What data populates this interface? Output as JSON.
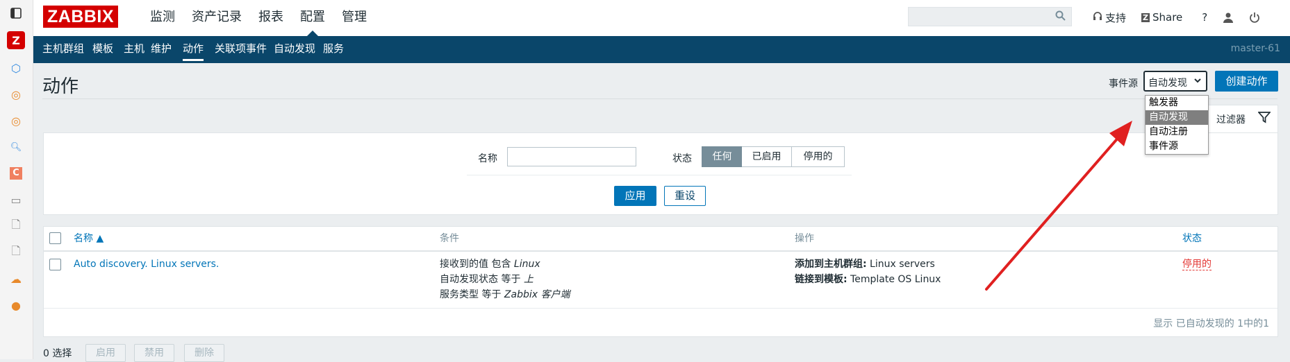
{
  "header": {
    "logo": "ZABBIX",
    "menu": [
      {
        "label": "监测"
      },
      {
        "label": "资产记录"
      },
      {
        "label": "报表"
      },
      {
        "label": "配置"
      },
      {
        "label": "管理"
      }
    ],
    "active_menu": "配置",
    "search_placeholder": "",
    "support_label": "支持",
    "share_label": "Share",
    "help_label": "?"
  },
  "submenu": {
    "items": [
      {
        "label": "主机群组"
      },
      {
        "label": "模板"
      },
      {
        "label": "主机"
      },
      {
        "label": "维护"
      },
      {
        "label": "动作"
      },
      {
        "label": "关联项事件"
      },
      {
        "label": "自动发现"
      },
      {
        "label": "服务"
      }
    ],
    "active": "动作",
    "node_name": "master-61"
  },
  "page": {
    "title": "动作",
    "event_source_label": "事件源",
    "event_source_value": "自动发现",
    "event_source_options": [
      "触发器",
      "自动发现",
      "自动注册",
      "事件源"
    ],
    "create_button": "创建动作",
    "filter_tab_label": "过滤器"
  },
  "filter": {
    "name_label": "名称",
    "name_value": "",
    "status_label": "状态",
    "status_options": [
      "任何",
      "已启用",
      "停用的"
    ],
    "status_selected": "任何",
    "apply_button": "应用",
    "reset_button": "重设"
  },
  "table": {
    "columns": {
      "name": "名称 ▲",
      "conditions": "条件",
      "operations": "操作",
      "status": "状态"
    },
    "rows": [
      {
        "name": "Auto discovery. Linux servers.",
        "conditions": [
          {
            "prefix": "接收到的值 包含 ",
            "value": "Linux"
          },
          {
            "prefix": "自动发现状态 等于 ",
            "value": "上"
          },
          {
            "prefix": "服务类型 等于 ",
            "value": "Zabbix 客户端"
          }
        ],
        "operations": [
          {
            "key": "添加到主机群组:",
            "value": " Linux servers"
          },
          {
            "key": "链接到模板:",
            "value": " Template OS Linux"
          }
        ],
        "status": "停用的"
      }
    ],
    "footer": "显示 已自动发现的 1中的1"
  },
  "bulk": {
    "selected": "0 选择",
    "buttons": [
      "启用",
      "禁用",
      "删除"
    ]
  },
  "colors": {
    "brand": "#d40000",
    "submenu_bg": "#0a466a",
    "primary": "#0275b8",
    "disabled_status": "#e33734",
    "annotation_arrow": "#e02020"
  }
}
